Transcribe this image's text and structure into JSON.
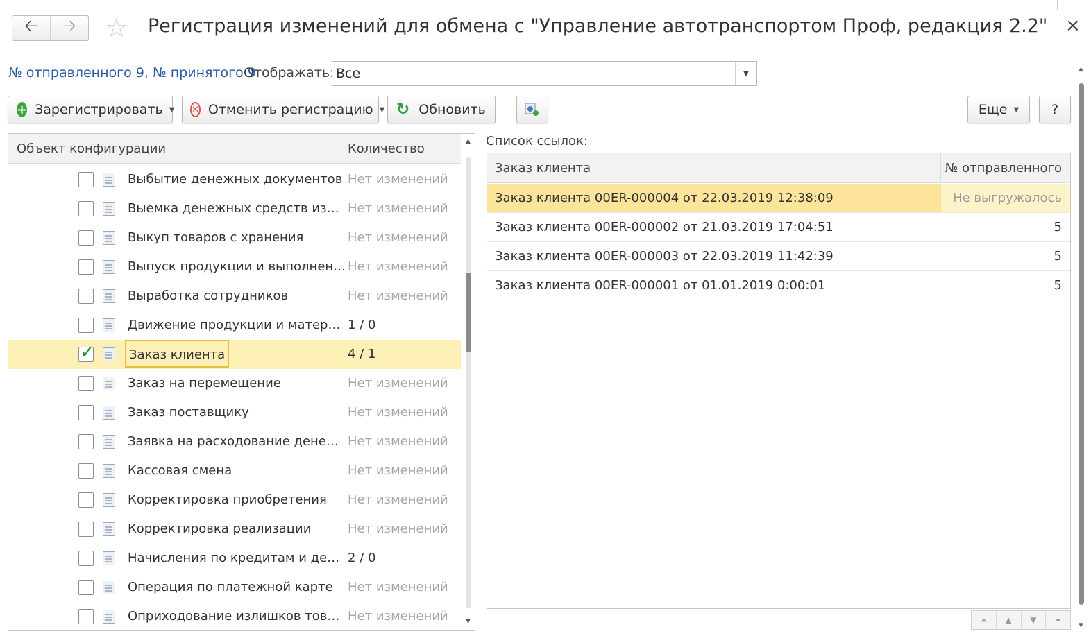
{
  "window": {
    "title": "Регистрация изменений для обмена с  \"Управление автотранспортом Проф, редакция 2.2\"",
    "close": "×",
    "back": "🡠",
    "forward": "🡢",
    "favorite": "☆"
  },
  "header": {
    "exchange_link": "№ отправленного 9, № принятого 9",
    "display_label": "Отображать:",
    "display_value": "Все"
  },
  "toolbar": {
    "register": "Зарегистрировать",
    "cancel_registration": "Отменить регистрацию",
    "refresh": "Обновить",
    "more": "Еще",
    "help": "?"
  },
  "left_table": {
    "col_object": "Объект конфигурации",
    "col_count": "Количество",
    "rows": [
      {
        "name": "Выбытие денежных документов",
        "count": "Нет изменений",
        "checked": false
      },
      {
        "name": "Выемка денежных средств из…",
        "count": "Нет изменений",
        "checked": false
      },
      {
        "name": "Выкуп товаров с хранения",
        "count": "Нет изменений",
        "checked": false
      },
      {
        "name": "Выпуск продукции и выполнен…",
        "count": "Нет изменений",
        "checked": false
      },
      {
        "name": "Выработка сотрудников",
        "count": "Нет изменений",
        "checked": false
      },
      {
        "name": "Движение продукции и матер…",
        "count": "1 / 0",
        "checked": false
      },
      {
        "name": "Заказ клиента",
        "count": "4 / 1",
        "checked": true,
        "selected": true
      },
      {
        "name": "Заказ на перемещение",
        "count": "Нет изменений",
        "checked": false
      },
      {
        "name": "Заказ поставщику",
        "count": "Нет изменений",
        "checked": false
      },
      {
        "name": "Заявка на расходование дене…",
        "count": "Нет изменений",
        "checked": false
      },
      {
        "name": "Кассовая смена",
        "count": "Нет изменений",
        "checked": false
      },
      {
        "name": "Корректировка приобретения",
        "count": "Нет изменений",
        "checked": false
      },
      {
        "name": "Корректировка реализации",
        "count": "Нет изменений",
        "checked": false
      },
      {
        "name": "Начисления по кредитам и де…",
        "count": "2 / 0",
        "checked": false
      },
      {
        "name": "Операция по платежной карте",
        "count": "Нет изменений",
        "checked": false
      },
      {
        "name": "Оприходование излишков тов…",
        "count": "Нет изменений",
        "checked": false
      }
    ]
  },
  "right_panel": {
    "label": "Список ссылок:",
    "col_order": "Заказ клиента",
    "col_sent": "№ отправленного",
    "rows": [
      {
        "name": "Заказ клиента 00ER-000004 от 22.03.2019 12:38:09",
        "sent": "Не выгружалось",
        "selected": true
      },
      {
        "name": "Заказ клиента 00ER-000002 от 21.03.2019 17:04:51",
        "sent": "5"
      },
      {
        "name": "Заказ клиента 00ER-000003 от 22.03.2019 11:42:39",
        "sent": "5"
      },
      {
        "name": "Заказ клиента 00ER-000001 от 01.01.2019 0:00:01",
        "sent": "5"
      }
    ]
  },
  "colors": {
    "selection_row": "#fcf0b7",
    "selection_border": "#e9c03c",
    "link": "#2a5aa5",
    "check": "#1f8c3c"
  }
}
